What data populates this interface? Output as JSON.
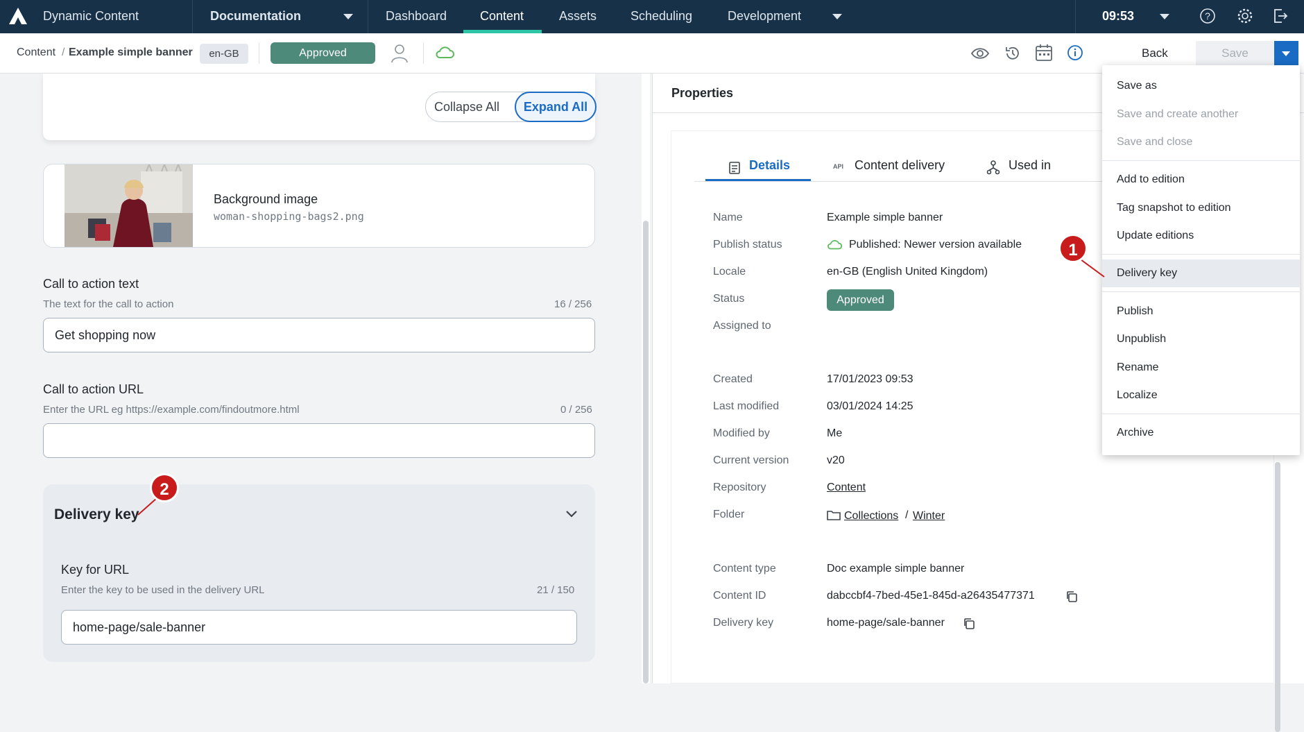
{
  "topnav": {
    "app_name": "Dynamic Content",
    "hub": "Documentation",
    "items": [
      "Dashboard",
      "Content",
      "Assets",
      "Scheduling",
      "Development"
    ],
    "active": "Content",
    "time": "09:53"
  },
  "toolbar": {
    "breadcrumb_root": "Content",
    "breadcrumb_sep": "/",
    "breadcrumb_item": "Example simple banner",
    "locale": "en-GB",
    "status": "Approved",
    "back_label": "Back",
    "save_label": "Save"
  },
  "editor": {
    "collapse_label": "Collapse All",
    "expand_label": "Expand All",
    "image": {
      "title": "Background image",
      "filename": "woman-shopping-bags2.png"
    },
    "cta_text": {
      "label": "Call to action text",
      "help": "The text for the call to action",
      "count": "16 / 256",
      "value": "Get shopping now"
    },
    "cta_url": {
      "label": "Call to action URL",
      "help": "Enter the URL eg https://example.com/findoutmore.html",
      "count": "0 / 256",
      "value": ""
    },
    "delivery": {
      "section_title": "Delivery key",
      "label": "Key for URL",
      "help": "Enter the key to be used in the delivery URL",
      "count": "21 / 150",
      "value": "home-page/sale-banner"
    }
  },
  "properties": {
    "title": "Properties",
    "tabs": [
      "Details",
      "Content delivery",
      "Used in"
    ],
    "active_tab": "Details",
    "rows": {
      "name": {
        "k": "Name",
        "v": "Example simple banner"
      },
      "publish_status": {
        "k": "Publish status",
        "v": "Published: Newer version available"
      },
      "locale": {
        "k": "Locale",
        "v": "en-GB (English United Kingdom)"
      },
      "status": {
        "k": "Status",
        "v": "Approved"
      },
      "assigned": {
        "k": "Assigned to",
        "v": ""
      },
      "created": {
        "k": "Created",
        "v": "17/01/2023 09:53"
      },
      "modified": {
        "k": "Last modified",
        "v": "03/01/2024 14:25"
      },
      "modified_by": {
        "k": "Modified by",
        "v": "Me"
      },
      "version": {
        "k": "Current version",
        "v": "v20"
      },
      "repo": {
        "k": "Repository",
        "v": "Content"
      },
      "folder": {
        "k": "Folder",
        "v1": "Collections",
        "sep": "/",
        "v2": "Winter"
      },
      "ctype": {
        "k": "Content type",
        "v": "Doc example simple banner"
      },
      "cid": {
        "k": "Content ID",
        "v": "dabccbf4-7bed-45e1-845d-a26435477371"
      },
      "dkey": {
        "k": "Delivery key",
        "v": "home-page/sale-banner"
      }
    }
  },
  "menu": {
    "items": [
      "Save as",
      "Save and create another",
      "Save and close",
      "Add to edition",
      "Tag snapshot to edition",
      "Update editions",
      "Delivery key",
      "Publish",
      "Unpublish",
      "Rename",
      "Localize",
      "Archive"
    ],
    "highlighted": "Delivery key"
  },
  "callouts": [
    "1",
    "2"
  ],
  "colors": {
    "nav_bg": "#173148",
    "accent": "#1a6bc4",
    "approved": "#4d8a79",
    "callout": "#c81c1c",
    "cloud": "#5cb85c"
  }
}
